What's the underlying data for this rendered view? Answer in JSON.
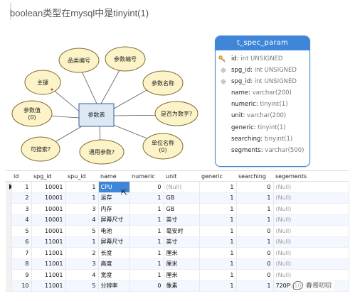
{
  "article": {
    "title": "boolean类型在mysql中是tinyint(1)"
  },
  "er_diagram": {
    "center": "参数表",
    "attributes": [
      {
        "label": "品类编号"
      },
      {
        "label": "参数编号"
      },
      {
        "label": "主键"
      },
      {
        "label": "参数名称"
      },
      {
        "label": "参数值\n(0)"
      },
      {
        "label": "是否为数字?"
      },
      {
        "label": "可搜索?"
      },
      {
        "label": "通用参数?"
      },
      {
        "label": "单位名称\n(0)"
      }
    ]
  },
  "table_schema": {
    "name": "t_spec_param",
    "fields": [
      {
        "name": "id",
        "type": "int UNSIGNED",
        "icon": "key-icon"
      },
      {
        "name": "spg_id",
        "type": "int UNSIGNED",
        "icon": "diamond-icon"
      },
      {
        "name": "spg_id",
        "type": "int UNSIGNED",
        "icon": "diamond-icon"
      },
      {
        "name": "name",
        "type": "varchar(200)",
        "icon": ""
      },
      {
        "name": "numeric",
        "type": "tinyint(1)",
        "icon": ""
      },
      {
        "name": "unit",
        "type": "varchar(200)",
        "icon": ""
      },
      {
        "name": "generic",
        "type": "tinyint(1)",
        "icon": ""
      },
      {
        "name": "searching",
        "type": "tinyint(1)",
        "icon": ""
      },
      {
        "name": "segments",
        "type": "varchar(500)",
        "icon": ""
      }
    ]
  },
  "grid": {
    "columns": [
      "id",
      "spg_id",
      "spu_id",
      "name",
      "numeric",
      "unit",
      "generic",
      "searching",
      "segements"
    ],
    "rows": [
      [
        "1",
        "10001",
        "1",
        "CPU",
        "0",
        "(Null)",
        "1",
        "0",
        "(Null)"
      ],
      [
        "2",
        "10001",
        "1",
        "运存",
        "1",
        "GB",
        "1",
        "1",
        "(Null)"
      ],
      [
        "3",
        "10001",
        "3",
        "内存",
        "1",
        "GB",
        "1",
        "1",
        "(Null)"
      ],
      [
        "4",
        "10001",
        "4",
        "屏幕尺寸",
        "1",
        "英寸",
        "1",
        "1",
        "(Null)"
      ],
      [
        "5",
        "10001",
        "5",
        "电池",
        "1",
        "毫安时",
        "1",
        "0",
        "(Null)"
      ],
      [
        "6",
        "11001",
        "1",
        "屏幕尺寸",
        "1",
        "英寸",
        "1",
        "1",
        "(Null)"
      ],
      [
        "7",
        "11001",
        "2",
        "长度",
        "1",
        "厘米",
        "1",
        "0",
        "(Null)"
      ],
      [
        "8",
        "11001",
        "3",
        "高度",
        "1",
        "厘米",
        "1",
        "0",
        "(Null)"
      ],
      [
        "9",
        "11001",
        "4",
        "宽度",
        "1",
        "厘米",
        "1",
        "0",
        "(Null)"
      ],
      [
        "10",
        "11001",
        "5",
        "分辨率",
        "0",
        "像素",
        "1",
        "1",
        "720P\\(10"
      ]
    ]
  },
  "watermark": {
    "text": "春哥叨叨"
  },
  "colors": {
    "accent": "#3f86d8",
    "ellipse_fill": "#fdf3c8",
    "center_fill": "#dde8f5",
    "null_text": "#9a9a9a"
  }
}
